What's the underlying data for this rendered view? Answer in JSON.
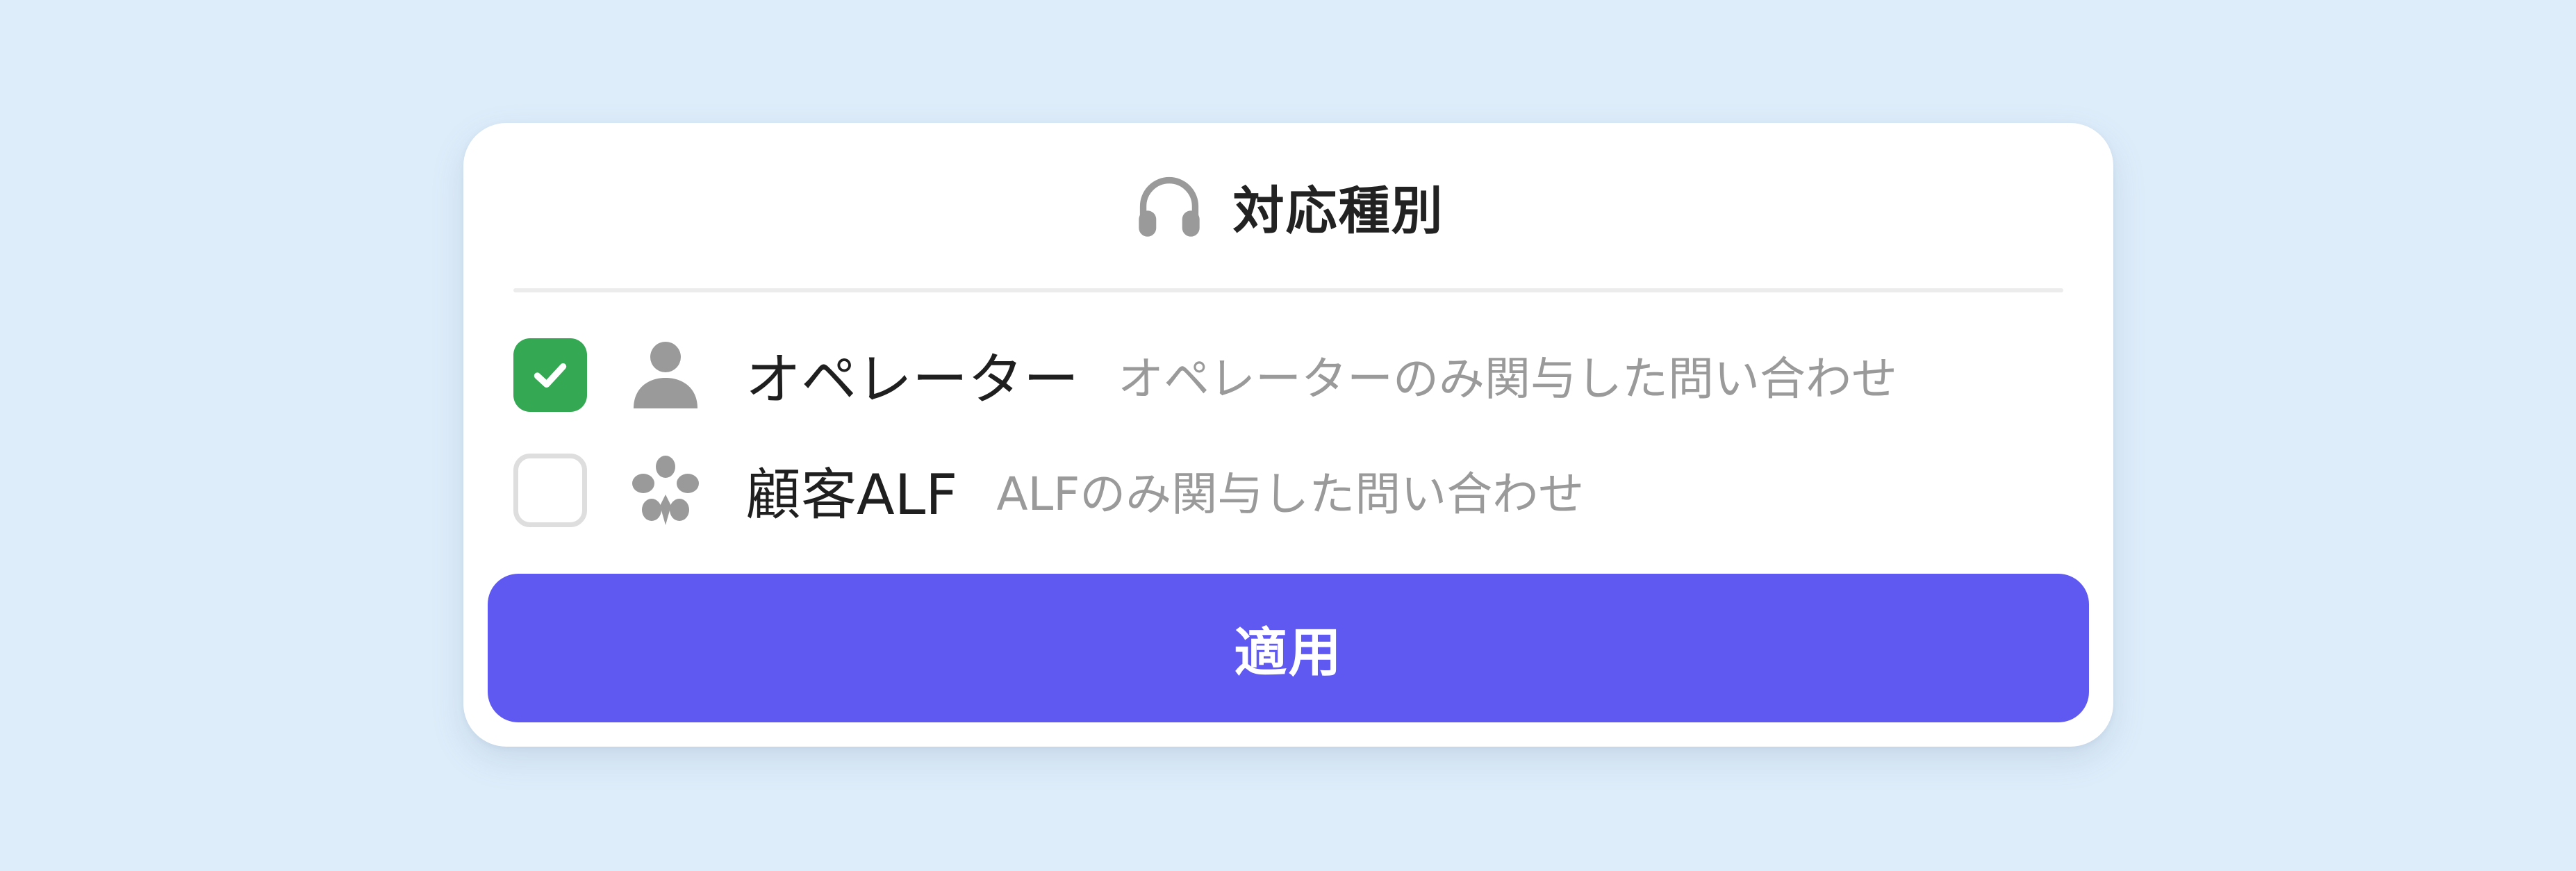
{
  "panel": {
    "title": "対応種別",
    "title_icon": "headphones-icon",
    "options": [
      {
        "label": "オペレーター",
        "description": "オペレーターのみ関与した問い合わせ",
        "checked": true,
        "icon": "person-icon"
      },
      {
        "label": "顧客ALF",
        "description": "ALFのみ関与した問い合わせ",
        "checked": false,
        "icon": "flower-icon"
      }
    ],
    "apply_label": "適用"
  },
  "colors": {
    "background": "#deedfa",
    "card": "#ffffff",
    "checked": "#34a853",
    "accent": "#5f59f1",
    "icon": "#9a9a9a",
    "description_text": "#9a9a9a"
  }
}
